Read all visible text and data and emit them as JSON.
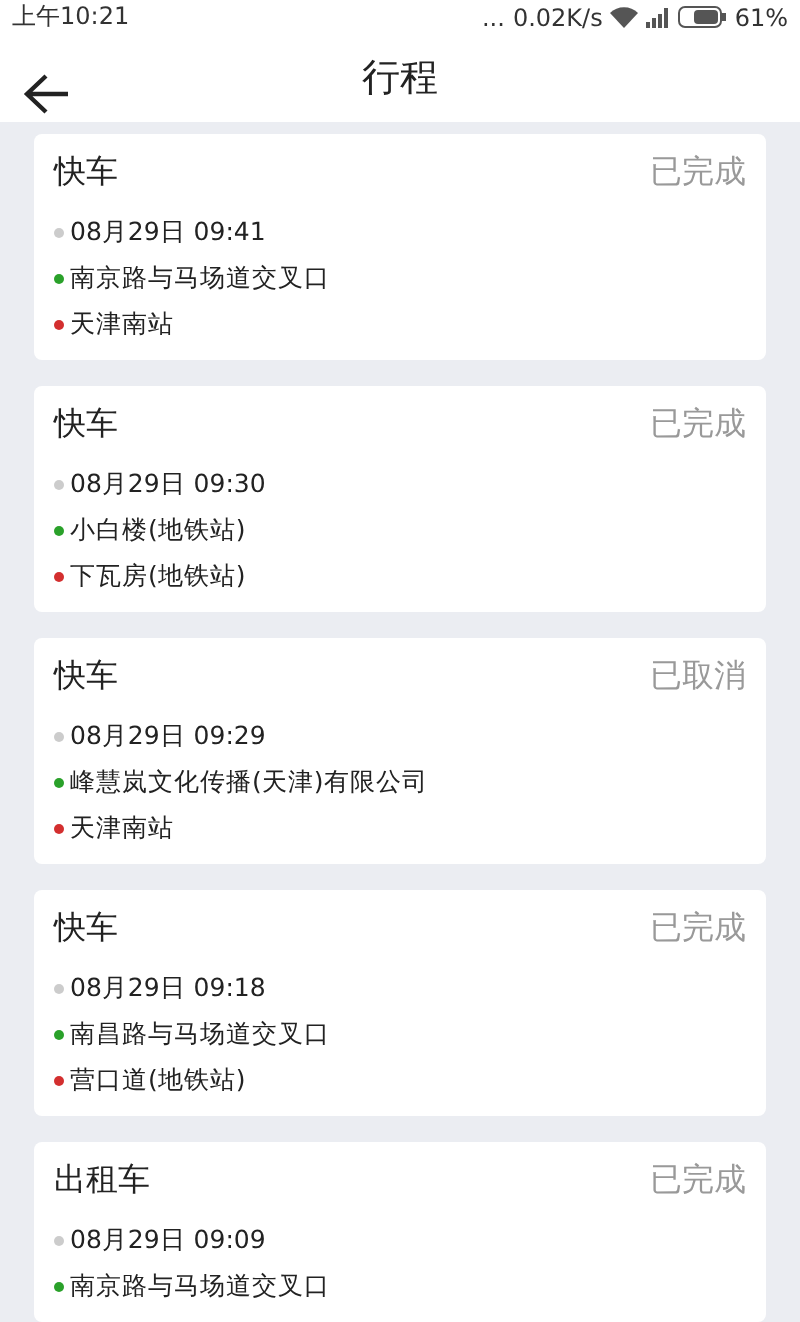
{
  "status_bar": {
    "time": "上午10:21",
    "dots": "...",
    "speed": "0.02K/s",
    "battery": "61%"
  },
  "header": {
    "title": "行程"
  },
  "trips": [
    {
      "type": "快车",
      "status": "已完成",
      "time": "08月29日 09:41",
      "from": "南京路与马场道交叉口",
      "to": "天津南站"
    },
    {
      "type": "快车",
      "status": "已完成",
      "time": "08月29日 09:30",
      "from": "小白楼(地铁站)",
      "to": "下瓦房(地铁站)"
    },
    {
      "type": "快车",
      "status": "已取消",
      "time": "08月29日 09:29",
      "from": "峰慧岚文化传播(天津)有限公司",
      "to": "天津南站"
    },
    {
      "type": "快车",
      "status": "已完成",
      "time": "08月29日 09:18",
      "from": "南昌路与马场道交叉口",
      "to": "营口道(地铁站)"
    },
    {
      "type": "出租车",
      "status": "已完成",
      "time": "08月29日 09:09",
      "from": "南京路与马场道交叉口"
    }
  ]
}
